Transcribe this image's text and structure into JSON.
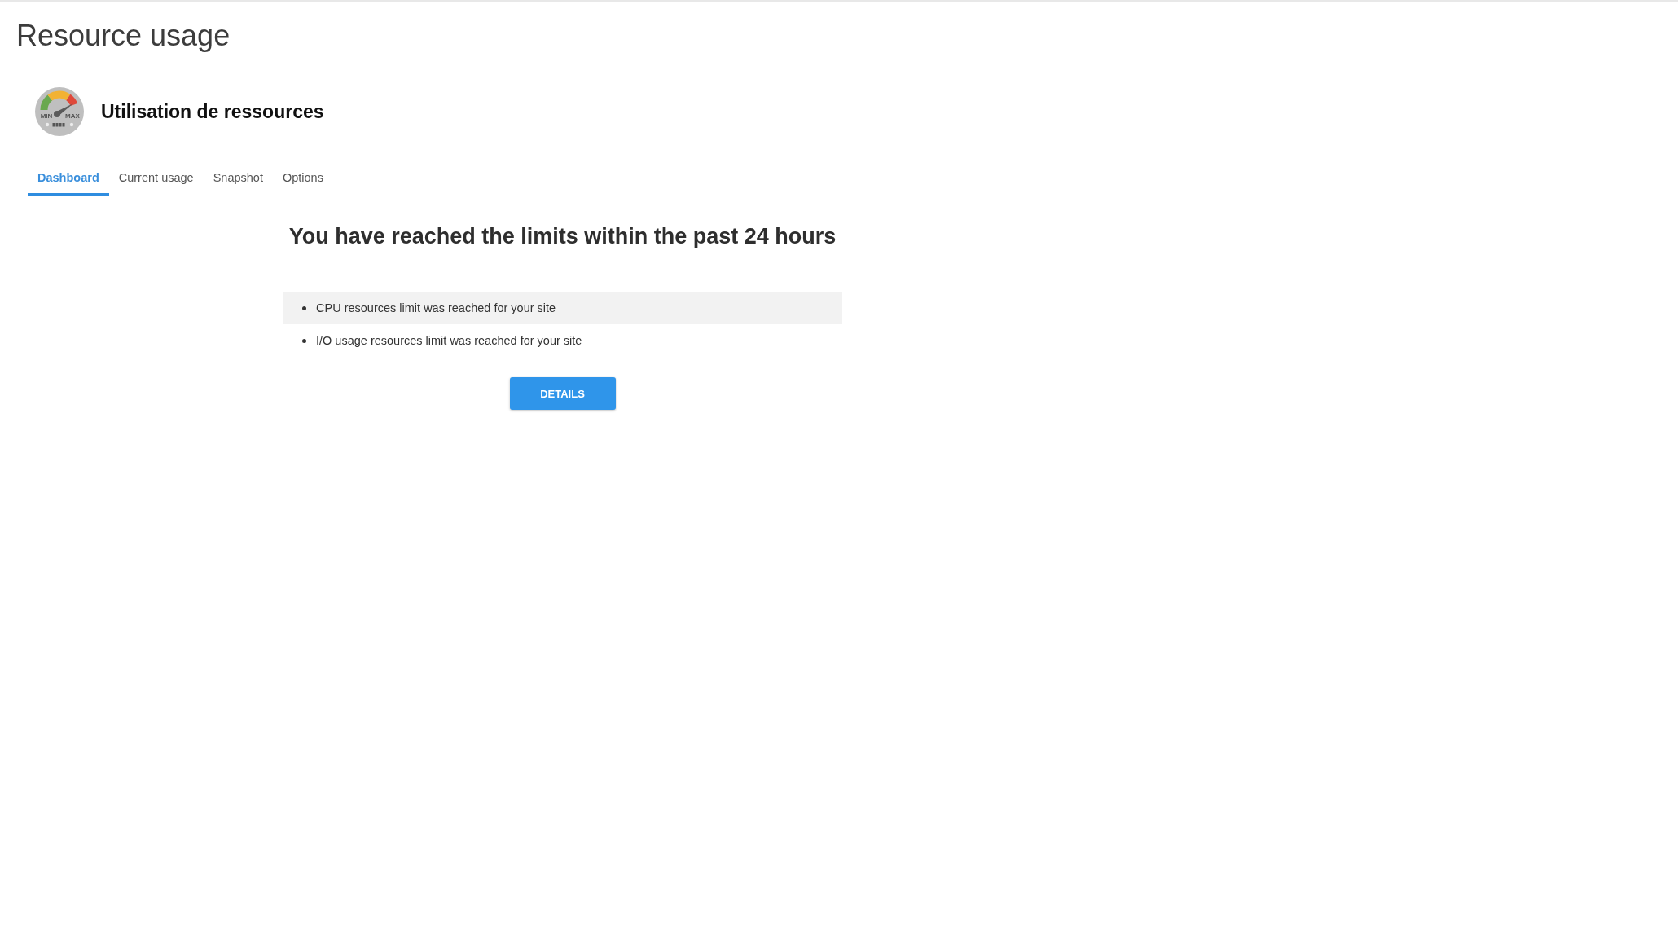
{
  "page": {
    "title": "Resource usage"
  },
  "app": {
    "name": "Utilisation de ressources",
    "gauge_labels": [
      "MIN",
      "MAX"
    ]
  },
  "tabs": [
    {
      "label": "Dashboard",
      "selected": true
    },
    {
      "label": "Current usage",
      "selected": false
    },
    {
      "label": "Snapshot",
      "selected": false
    },
    {
      "label": "Options",
      "selected": false
    }
  ],
  "alert": {
    "heading": "You have reached the limits within the past 24 hours",
    "items": [
      {
        "text": "CPU resources limit was reached for your site",
        "highlighted": true
      },
      {
        "text": "I/O usage resources limit was reached for your site",
        "highlighted": false
      }
    ],
    "button": "DETAILS"
  }
}
